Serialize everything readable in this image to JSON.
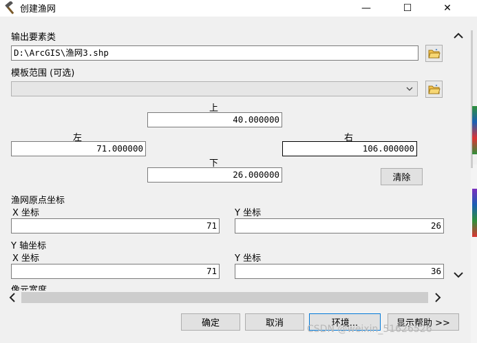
{
  "window": {
    "title": "创建渔网",
    "minimize_glyph": "—",
    "maximize_glyph": "☐",
    "close_glyph": "✕"
  },
  "output": {
    "label": "输出要素类",
    "value": "D:\\ArcGIS\\渔网3.shp"
  },
  "template": {
    "label": "模板范围 (可选)",
    "value": ""
  },
  "extent": {
    "top_label": "上",
    "top_value": "40.000000",
    "left_label": "左",
    "left_value": "71.000000",
    "right_label": "右",
    "right_value": "106.000000",
    "bottom_label": "下",
    "bottom_value": "26.000000",
    "clear_label": "清除"
  },
  "origin": {
    "label": "渔网原点坐标",
    "x_label": "X 坐标",
    "x_value": "71",
    "y_label": "Y 坐标",
    "y_value": "26"
  },
  "yaxis": {
    "label": "Y 轴坐标",
    "x_label": "X 坐标",
    "x_value": "71",
    "y_label": "Y 坐标",
    "y_value": "36"
  },
  "cell": {
    "label": "像元宽度"
  },
  "buttons": {
    "ok": "确定",
    "cancel": "取消",
    "env": "环境...",
    "help": "显示帮助 >>"
  },
  "watermark": "CSDN @weixin_51626526",
  "icons": {
    "app": "hammer-icon",
    "folder": "open-folder-icon",
    "dropdown": "chevron-down-icon",
    "scroll_up": "chevron-up-icon",
    "scroll_down": "chevron-down-icon",
    "scroll_left": "chevron-left-icon",
    "scroll_right": "chevron-right-icon"
  }
}
